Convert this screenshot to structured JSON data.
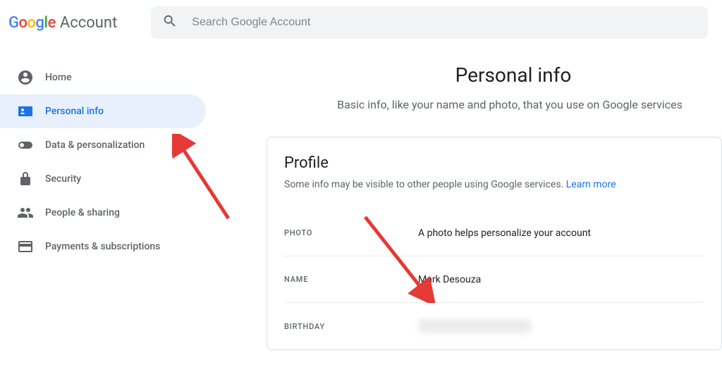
{
  "header": {
    "logo_brand": "Google",
    "logo_product": "Account",
    "search_placeholder": "Search Google Account"
  },
  "sidebar": {
    "items": [
      {
        "label": "Home"
      },
      {
        "label": "Personal info"
      },
      {
        "label": "Data & personalization"
      },
      {
        "label": "Security"
      },
      {
        "label": "People & sharing"
      },
      {
        "label": "Payments & subscriptions"
      }
    ]
  },
  "main": {
    "title": "Personal info",
    "subtitle": "Basic info, like your name and photo, that you use on Google services",
    "profile_card": {
      "title": "Profile",
      "description": "Some info may be visible to other people using Google services. ",
      "learn_more": "Learn more",
      "rows": {
        "photo": {
          "label": "PHOTO",
          "value": "A photo helps personalize your account"
        },
        "name": {
          "label": "NAME",
          "value": "Mark Desouza"
        },
        "birthday": {
          "label": "BIRTHDAY",
          "value": ""
        }
      }
    }
  }
}
